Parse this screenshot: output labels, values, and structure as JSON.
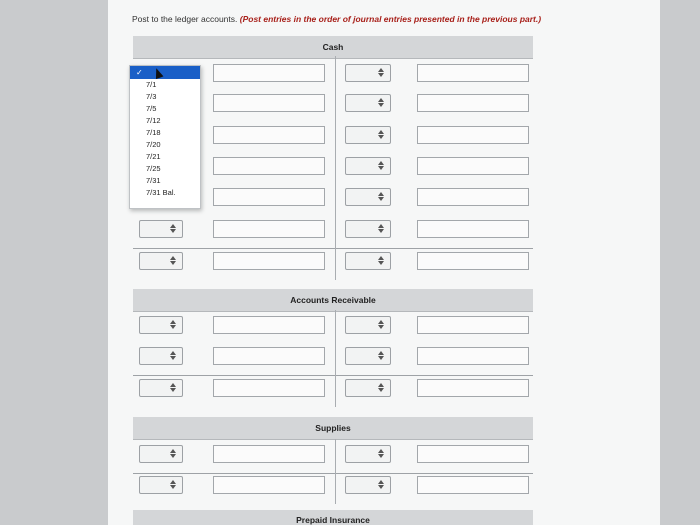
{
  "instructions": {
    "text": "Post to the ledger accounts.",
    "note": "(Post entries in the order of journal entries presented in the previous part.)"
  },
  "accounts": {
    "cash": "Cash",
    "accounts_receivable": "Accounts Receivable",
    "supplies": "Supplies",
    "prepaid_insurance": "Prepaid Insurance"
  },
  "date_dropdown": {
    "selected": "✓",
    "options": [
      "7/1",
      "7/3",
      "7/5",
      "7/12",
      "7/18",
      "7/20",
      "7/21",
      "7/25",
      "7/31",
      "7/31 Bal."
    ]
  }
}
